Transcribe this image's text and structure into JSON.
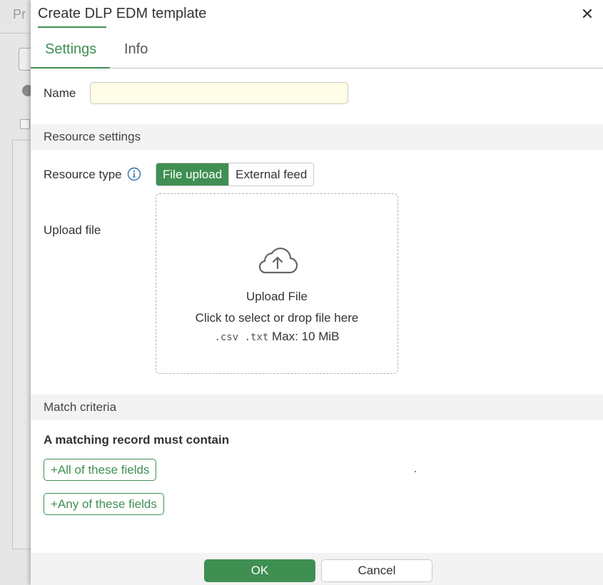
{
  "background": {
    "tab_label": "Pr"
  },
  "dialog": {
    "title": "Create DLP EDM template",
    "close_glyph": "✕",
    "tabs": [
      {
        "label": "Settings",
        "active": true
      },
      {
        "label": "Info",
        "active": false
      }
    ]
  },
  "settings": {
    "name_label": "Name",
    "name_value": "",
    "resource_section_title": "Resource settings",
    "resource_type_label": "Resource type",
    "resource_type_options": [
      "File upload",
      "External feed"
    ],
    "resource_type_selected": "File upload",
    "upload_file_label": "Upload file",
    "dropzone": {
      "title": "Upload File",
      "subtitle": "Click to select or drop file here",
      "extensions": ".csv .txt",
      "max_size": "Max: 10 MiB",
      "icon": "cloud-upload-icon"
    },
    "match_section_title": "Match criteria",
    "match_heading": "A matching record must contain",
    "all_fields_button": "+All of these fields",
    "any_fields_button": "+Any of these fields"
  },
  "footer": {
    "ok_label": "OK",
    "cancel_label": "Cancel"
  },
  "colors": {
    "accent": "#3f8f52",
    "input_bg": "#fffde7",
    "section_bg": "#f3f3f3"
  }
}
